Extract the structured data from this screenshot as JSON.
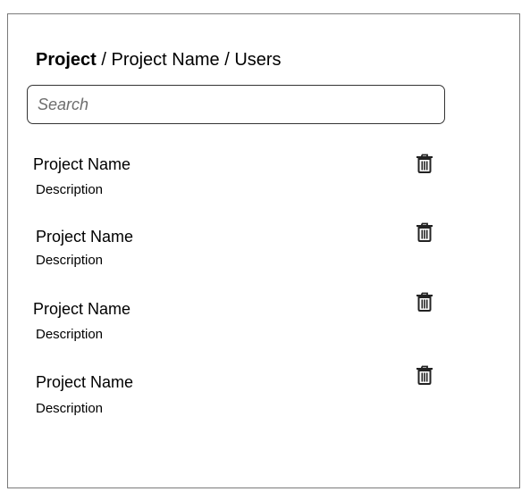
{
  "breadcrumb": {
    "root": "Project",
    "separator_1": " / ",
    "project": "Project Name",
    "separator_2": " / ",
    "section": "Users"
  },
  "search": {
    "placeholder": "Search",
    "value": ""
  },
  "items": [
    {
      "title": "Project Name",
      "description": "Description",
      "action_icon": "trash-icon"
    },
    {
      "title": "Project Name",
      "description": "Description",
      "action_icon": "trash-icon"
    },
    {
      "title": "Project Name",
      "description": "Description",
      "action_icon": "trash-icon"
    },
    {
      "title": "Project Name",
      "description": "Description",
      "action_icon": "trash-icon"
    }
  ]
}
